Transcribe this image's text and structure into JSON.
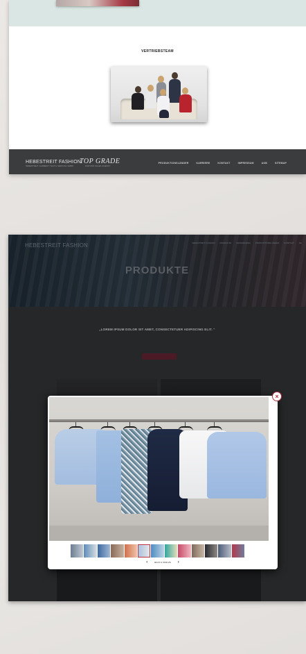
{
  "team_page": {
    "section_title": "VERTRIEBSTEAM",
    "footer": {
      "logo_main": "HEBESTREIT FASHION",
      "logo_main_sub": "HEBESTREIT GARMENT TEXTIL SERVICE GMBH",
      "logo_second": "TOP GRADE",
      "logo_second_sub": "FASHION SALES AGENCY",
      "nav": [
        "PRODUKTIONSLÄNDER",
        "KARRIERE",
        "KONTAKT",
        "IMPRESSUM",
        "AGB",
        "SITEMAP"
      ]
    }
  },
  "products_page": {
    "brand": "HEBESTREIT FASHION",
    "top_nav": [
      "HEBESTREIT FASHION",
      "PRODUKTE",
      "REFERENZEN",
      "PRODUKTIONSLÄNDER",
      "KONTAKT",
      "DE"
    ],
    "hero_title": "PRODUKTE",
    "quote": "„LOREM IPSUM DOLOR SIT AMET, CONSECTETUER ADIPISCING ELIT. “",
    "lightbox": {
      "close_glyph": "×",
      "prev_glyph": "‹",
      "next_glyph": "›",
      "counter": "BILD 9 VON 26",
      "thumbnails_count": 13,
      "active_thumbnail": 5
    }
  },
  "colors": {
    "accent": "#b02d3e",
    "footer_bg": "#3a3c3e",
    "mint_band": "#d9e6e3",
    "dark_bg": "#2c2e30"
  }
}
